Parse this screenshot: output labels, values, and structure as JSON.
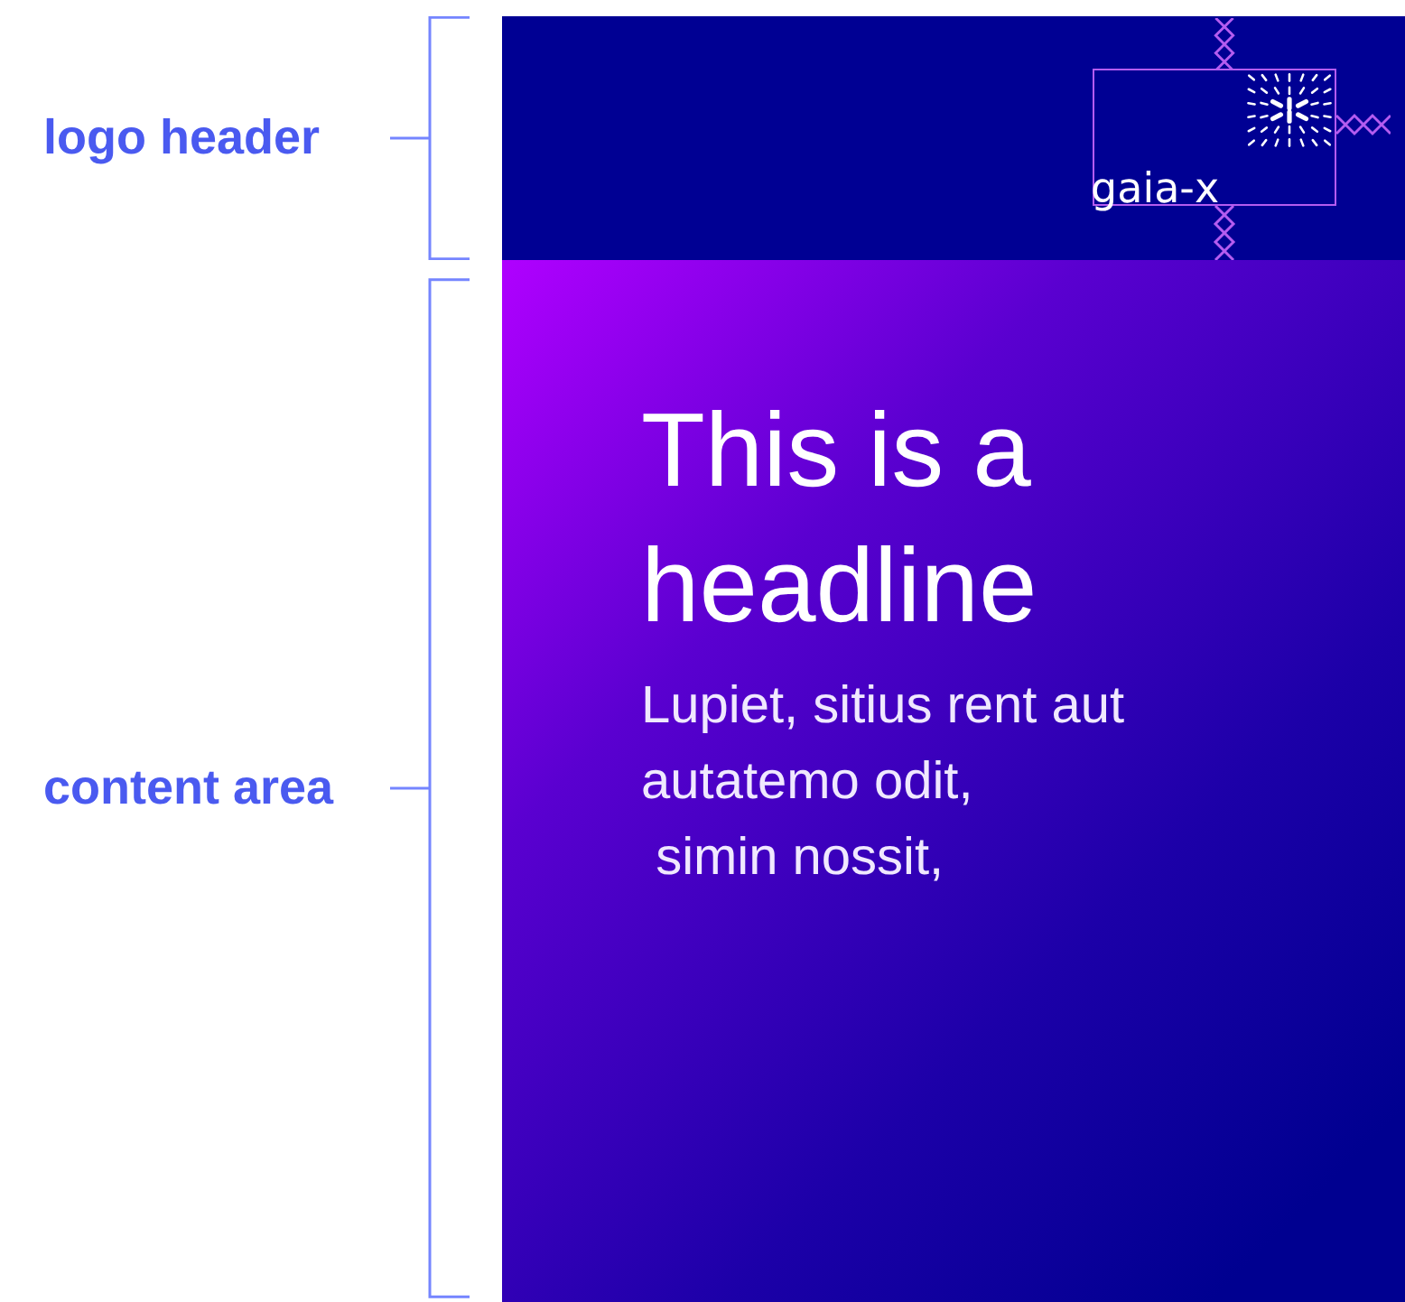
{
  "annotations": [
    {
      "label": "logo header"
    },
    {
      "label": "content area"
    }
  ],
  "header": {
    "logo": {
      "wordmark": "gaia-x"
    }
  },
  "content": {
    "headline": "This is a headline",
    "body": "Lupiet, sitius rent aut\nautatemo odit,\n simin nossit,"
  }
}
